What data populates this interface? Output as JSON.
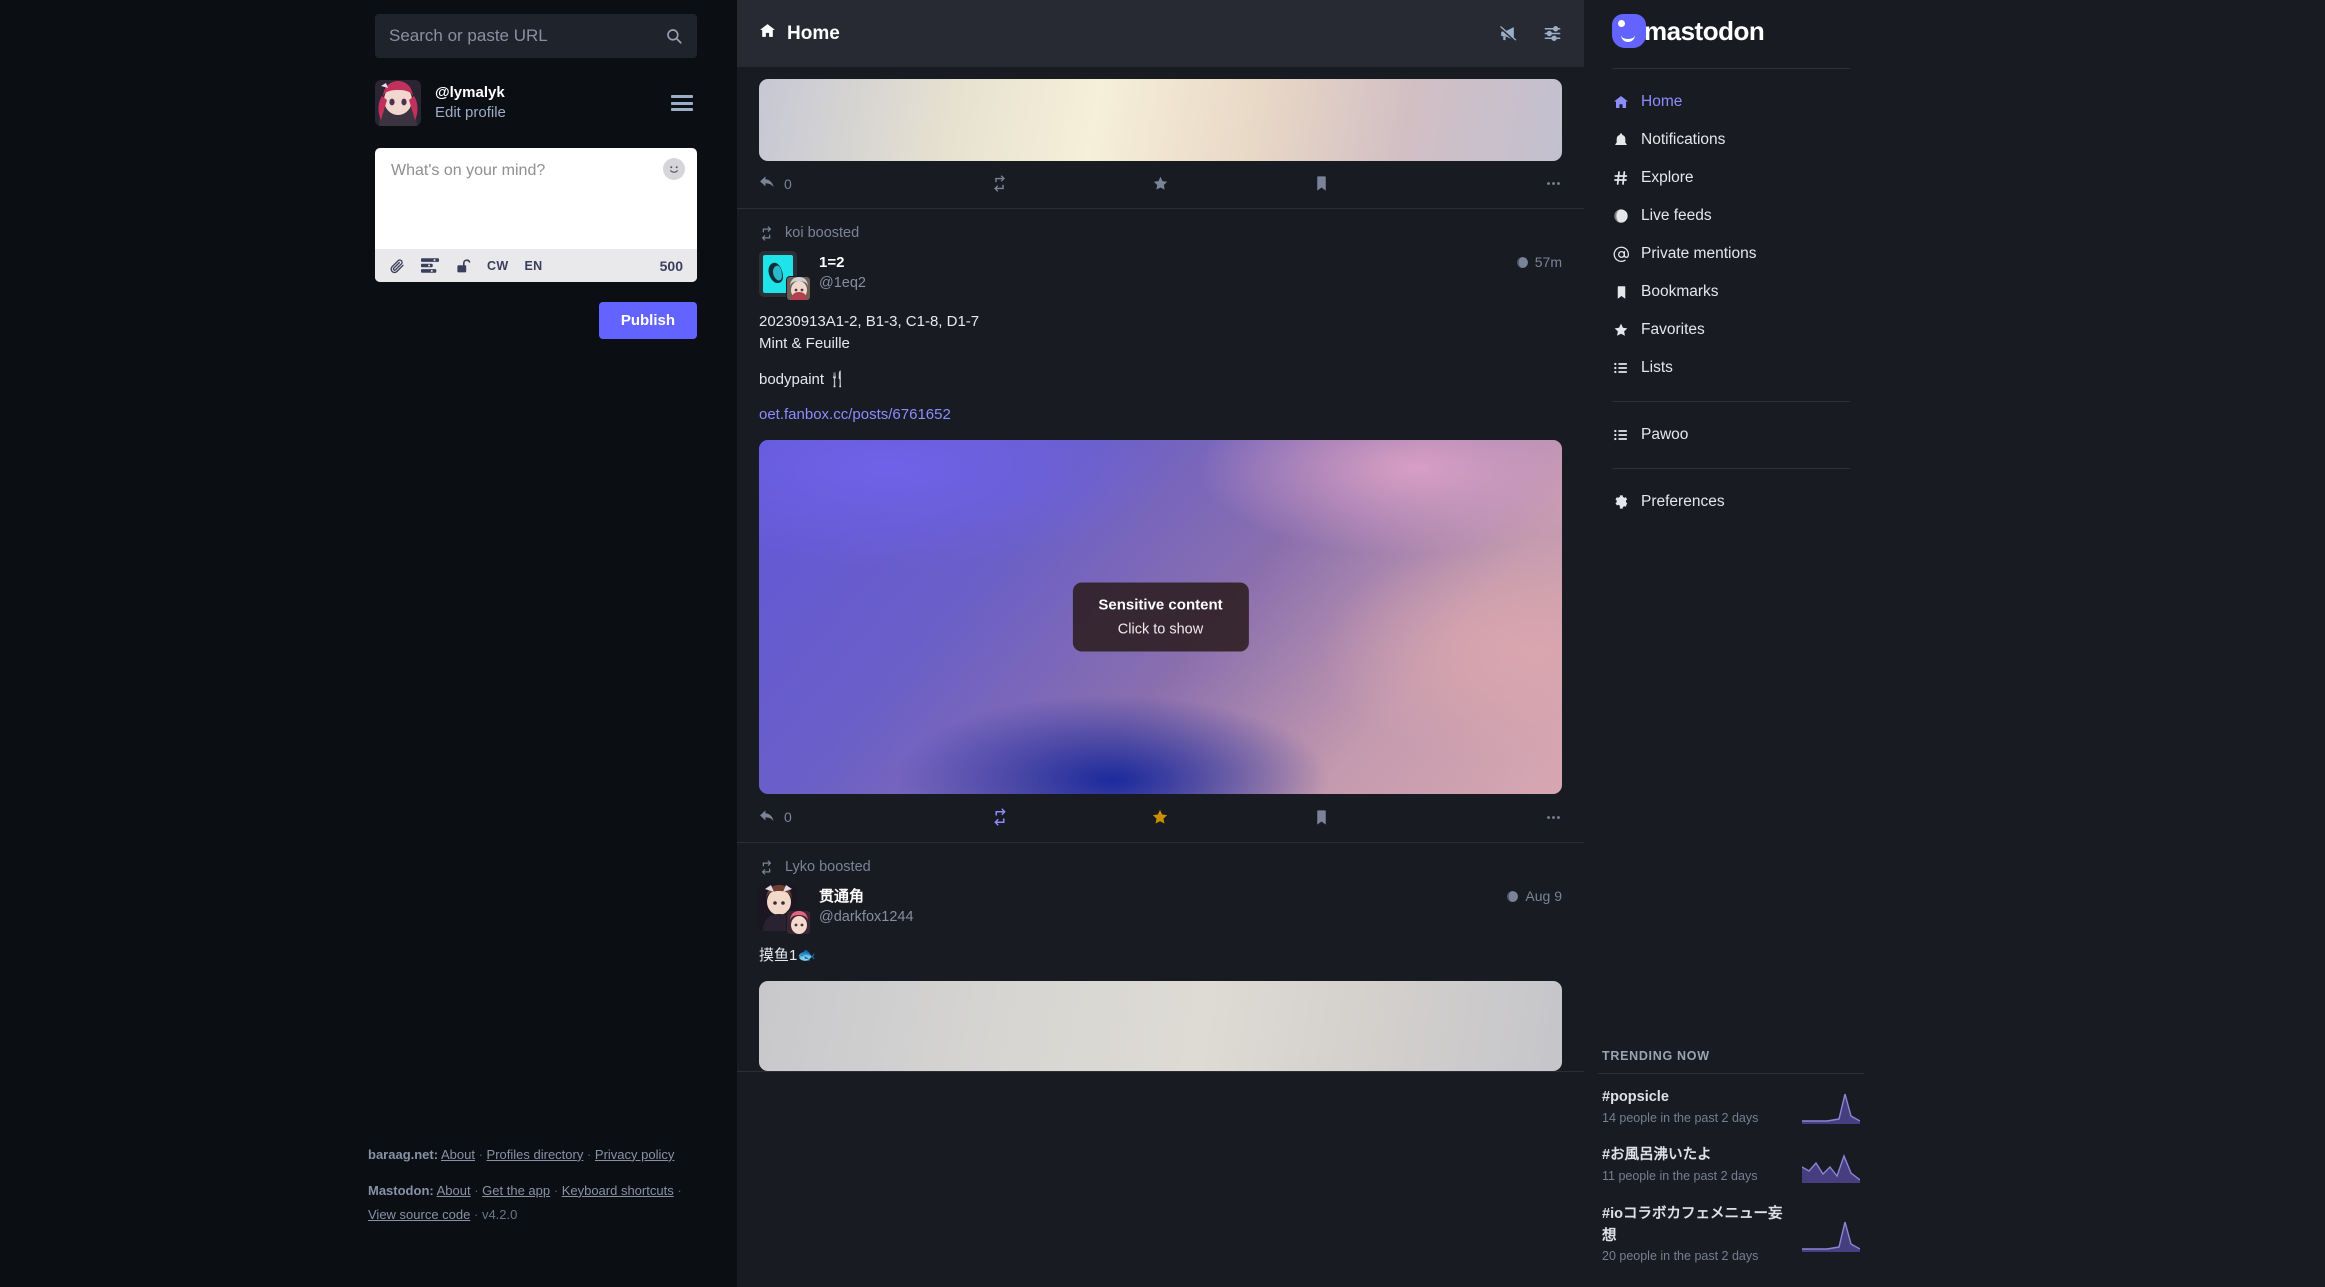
{
  "search": {
    "placeholder": "Search or paste URL",
    "icon": "search-icon"
  },
  "account": {
    "handle": "@lymalyk",
    "edit_profile": "Edit profile"
  },
  "composer": {
    "placeholder": "What's on your mind?",
    "cw_label": "CW",
    "lang_label": "EN",
    "char_count": "500",
    "publish_label": "Publish",
    "icons": [
      "attachment-icon",
      "poll-icon",
      "unlock-icon",
      "emoji-icon"
    ]
  },
  "left_footer": {
    "instance_name": "baraag.net:",
    "instance_links": [
      "About",
      "Profiles directory",
      "Privacy policy"
    ],
    "mastodon_name": "Mastodon:",
    "mastodon_links": [
      "About",
      "Get the app",
      "Keyboard shortcuts",
      "View source code"
    ],
    "version": "v4.2.0"
  },
  "column_header": {
    "title": "Home",
    "home_icon": "home-icon",
    "actions": [
      "megaphone-icon",
      "sliders-icon"
    ]
  },
  "statuses": [
    {
      "id": "status-top",
      "boost_label": null,
      "media_type": "gradient-banner",
      "actions": {
        "reply_count": "0",
        "boosted": false,
        "favourited": false,
        "bookmarked": false
      }
    },
    {
      "id": "status-koi",
      "boost_label": "koi boosted",
      "display_name": "1=2",
      "acct": "@1eq2",
      "time": "57m",
      "visibility_icon": "globe-icon",
      "body_lines": [
        "20230913A1-2, B1-3, C1-8, D1-7",
        "Mint & Feuille"
      ],
      "body_second": "bodypaint 🍴",
      "link_text": "oet.fanbox.cc/posts/6761652",
      "sensitive": {
        "title": "Sensitive content",
        "subtitle": "Click to show"
      },
      "actions": {
        "reply_count": "0",
        "boosted": true,
        "favourited": true,
        "bookmarked": false
      }
    },
    {
      "id": "status-lyko",
      "boost_label": "Lyko boosted",
      "display_name": "贯通角",
      "acct": "@darkfox1244",
      "time": "Aug 9",
      "visibility_icon": "globe-icon",
      "body_second": "摸鱼1🐟"
    }
  ],
  "nav": {
    "items": [
      {
        "label": "Home",
        "icon": "home-icon",
        "active": true
      },
      {
        "label": "Notifications",
        "icon": "bell-icon",
        "active": false
      },
      {
        "label": "Explore",
        "icon": "hash-icon",
        "active": false
      },
      {
        "label": "Live feeds",
        "icon": "globe-icon",
        "active": false
      },
      {
        "label": "Private mentions",
        "icon": "at-icon",
        "active": false
      },
      {
        "label": "Bookmarks",
        "icon": "bookmark-icon",
        "active": false
      },
      {
        "label": "Favorites",
        "icon": "star-icon",
        "active": false
      },
      {
        "label": "Lists",
        "icon": "list-icon",
        "active": false
      }
    ],
    "group2": [
      {
        "label": "Pawoo",
        "icon": "list-icon",
        "active": false
      }
    ],
    "group3": [
      {
        "label": "Preferences",
        "icon": "gear-icon",
        "active": false
      }
    ]
  },
  "trending": {
    "title": "TRENDING NOW",
    "items": [
      {
        "tag": "#popsicle",
        "sub": "14 people in the past 2 days",
        "spark": [
          2,
          2,
          2,
          2,
          2,
          3,
          22,
          4,
          2
        ]
      },
      {
        "tag": "#お風呂沸いたよ",
        "sub": "11 people in the past 2 days",
        "spark": [
          9,
          6,
          11,
          5,
          9,
          3,
          18,
          2,
          1
        ]
      },
      {
        "tag": "#ioコラボカフェメニュー妄想",
        "sub": "20 people in the past 2 days",
        "spark": [
          2,
          2,
          2,
          2,
          2,
          3,
          22,
          4,
          2
        ]
      }
    ]
  },
  "colors": {
    "accent": "#6364ff",
    "boost_active": "#8c8dff",
    "fav_active": "#ca8f04",
    "column_bg": "#191b22",
    "header_bg": "#272a33",
    "page_bg": "#0b0e13"
  }
}
